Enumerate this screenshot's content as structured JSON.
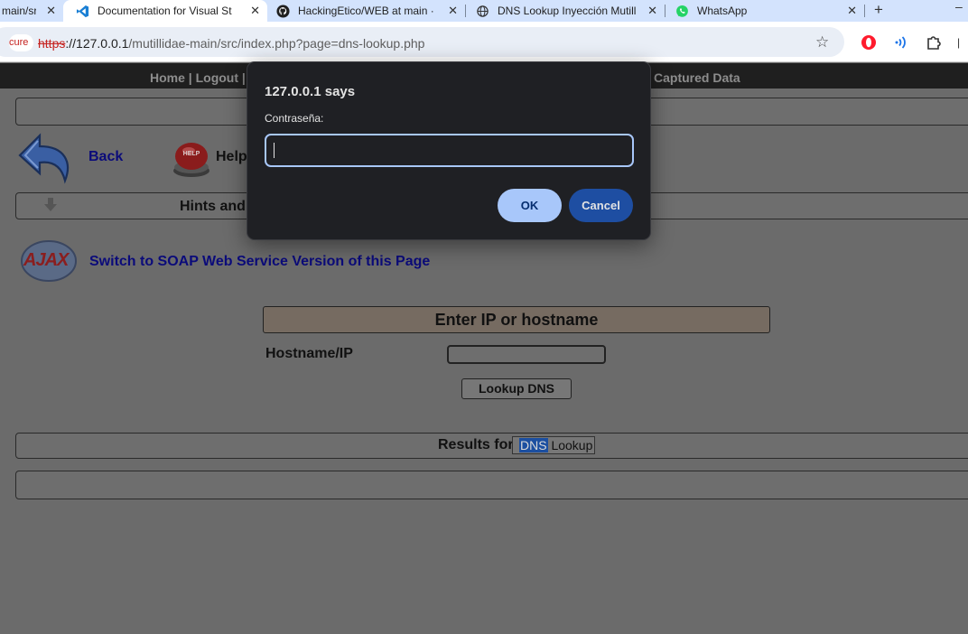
{
  "tabs": [
    {
      "title": "main/src",
      "icon": "page-icon"
    },
    {
      "title": "Documentation for Visual St",
      "icon": "vscode-icon"
    },
    {
      "title": "HackingEtico/WEB at main ·",
      "icon": "github-icon"
    },
    {
      "title": "DNS Lookup Inyección Mutill",
      "icon": "globe-icon"
    },
    {
      "title": "WhatsApp",
      "icon": "whatsapp-icon"
    }
  ],
  "tab_close_glyph": "✕",
  "newtab_glyph": "+",
  "minimize_glyph": "–",
  "address_bar": {
    "security_label": "cure",
    "scheme": "https",
    "host": "://127.0.0.1",
    "path": "/mutillidae-main/src/index.php?page=dns-lookup.php"
  },
  "page": {
    "menu_left": "Home | Logout | T",
    "menu_right": "Captured Data",
    "back_label": "Back",
    "help_label": "Help",
    "hints_label": "Hints and",
    "ajax_label": "AJAX",
    "soap_link": "Switch to SOAP Web Service Version of this Page",
    "form_header": "Enter IP or hostname",
    "hostname_label": "Hostname/IP",
    "hostname_value": "",
    "lookup_button": "Lookup DNS",
    "results_for": "Results for",
    "results_dns": "DNS",
    "results_lookup": " Lookup"
  },
  "dialog": {
    "title": "127.0.0.1 says",
    "label": "Contraseña:",
    "input_value": "",
    "ok": "OK",
    "cancel": "Cancel"
  }
}
